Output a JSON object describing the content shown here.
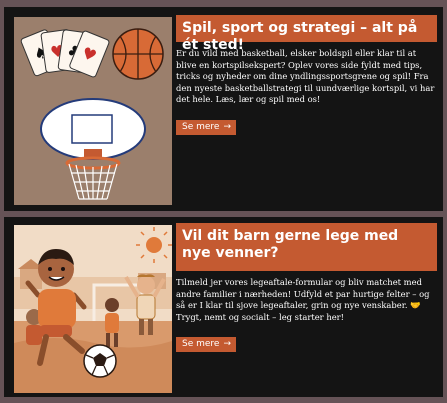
{
  "cards": [
    {
      "title": "Spil, sport og strategi – alt på ét sted!",
      "body": "Er du vild med basketball, elsker boldspil eller klar til at blive en kortspilsekspert? Oplev vores side fyldt med tips, tricks og nyheder om dine yndlingssportsgrene og spil! Fra den nyeste basketballstrategi til uundværlige kortspil, vi har det hele. Læs, lær og spil med os!",
      "button_label": "Se mere",
      "button_arrow": "→"
    },
    {
      "title": "Vil dit barn gerne lege med nye venner?",
      "body": "Tilmeld jer vores legeaftale-formular og bliv matchet med andre familier i nærheden! Udfyld et par hurtige felter – og så er I klar til sjove legeaftaler, grin og nye venskaber. 🤝 Trygt, nemt og socialt – leg starter her!",
      "button_label": "Se mere",
      "button_arrow": "→"
    }
  ],
  "colors": {
    "page_background": "#665357",
    "card_background": "#141414",
    "accent": "#c45a31",
    "text": "#ffffff"
  },
  "icons": {
    "card1_image": "playing-cards-basketball-hoop-illustration",
    "card2_image": "kids-playing-soccer-illustration"
  }
}
